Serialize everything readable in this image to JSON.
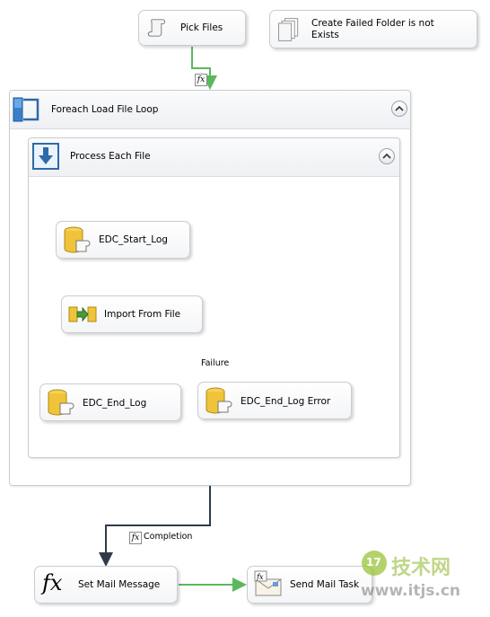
{
  "tasks": {
    "pick_files": "Pick Files",
    "create_failed_folder": "Create Failed Folder is not Exists",
    "set_mail_message": "Set Mail Message",
    "send_mail_task": "Send Mail Task"
  },
  "foreach": {
    "title": "Foreach Load File Loop",
    "inner": {
      "title": "Process Each File",
      "tasks": {
        "start_log": "EDC_Start_Log",
        "import": "Import From File",
        "end_log": "EDC_End_Log",
        "end_log_error": "EDC_End_Log Error"
      }
    }
  },
  "connectors": {
    "failure_label": "Failure",
    "completion_label": "Completion",
    "expression_badge": "fx"
  },
  "watermark": {
    "brand_cn": "技术网",
    "logo_digits": "17",
    "url": "www.itjs.cn"
  },
  "colors": {
    "success": "#5cb85c",
    "failure": "#b03a0e",
    "completion": "#2f3b4a"
  }
}
